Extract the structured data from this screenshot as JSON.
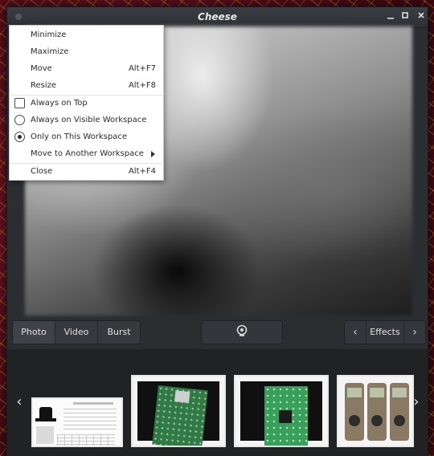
{
  "window": {
    "title": "Cheese",
    "buttons": {
      "minimize": "minimize-icon",
      "maximize": "maximize-icon",
      "close": "close-icon"
    }
  },
  "context_menu": {
    "items": [
      {
        "label": "Minimize",
        "accel": ""
      },
      {
        "label": "Maximize",
        "accel": ""
      },
      {
        "label": "Move",
        "accel": "Alt+F7"
      },
      {
        "label": "Resize",
        "accel": "Alt+F8"
      },
      {
        "label": "Always on Top",
        "accel": "",
        "type": "checkbox",
        "checked": false
      },
      {
        "label": "Always on Visible Workspace",
        "accel": "",
        "type": "radio",
        "checked": false
      },
      {
        "label": "Only on This Workspace",
        "accel": "",
        "type": "radio",
        "checked": true
      },
      {
        "label": "Move to Another Workspace",
        "accel": "",
        "submenu": true
      },
      {
        "label": "Close",
        "accel": "Alt+F4"
      }
    ]
  },
  "modes": {
    "photo": "Photo",
    "video": "Video",
    "burst": "Burst",
    "active": "Photo"
  },
  "shutter": {
    "icon": "webcam-icon"
  },
  "effects": {
    "label": "Effects",
    "prev": "‹",
    "next": "›"
  },
  "thumbnails": {
    "prev": "‹",
    "next": "›",
    "items": [
      {
        "kind": "document"
      },
      {
        "kind": "circuit-board"
      },
      {
        "kind": "circuit-board"
      },
      {
        "kind": "multimeters"
      }
    ]
  },
  "colors": {
    "window_bg": "#2b2e31",
    "menu_bg": "#ffffff",
    "desktop_bg": "#5a0f1a"
  }
}
